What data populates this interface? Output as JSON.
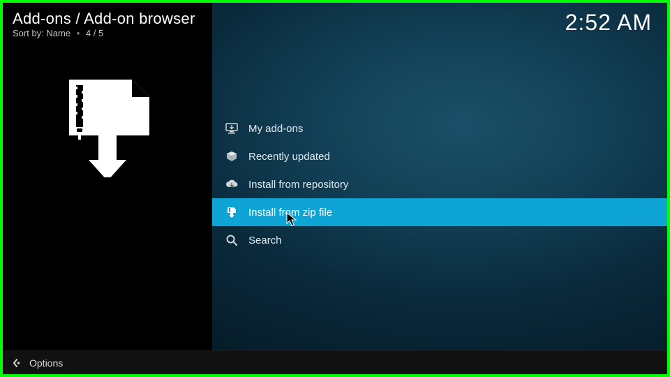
{
  "header": {
    "breadcrumb": "Add-ons / Add-on browser",
    "sort_label": "Sort by:",
    "sort_value": "Name",
    "position": "4 / 5",
    "clock": "2:52 AM"
  },
  "menu": {
    "items": [
      {
        "label": "My add-ons",
        "icon": "monitor-icon",
        "selected": false
      },
      {
        "label": "Recently updated",
        "icon": "box-icon",
        "selected": false
      },
      {
        "label": "Install from repository",
        "icon": "cloud-icon",
        "selected": false
      },
      {
        "label": "Install from zip file",
        "icon": "zip-icon",
        "selected": true
      },
      {
        "label": "Search",
        "icon": "search-icon",
        "selected": false
      }
    ]
  },
  "footer": {
    "options_label": "Options"
  }
}
